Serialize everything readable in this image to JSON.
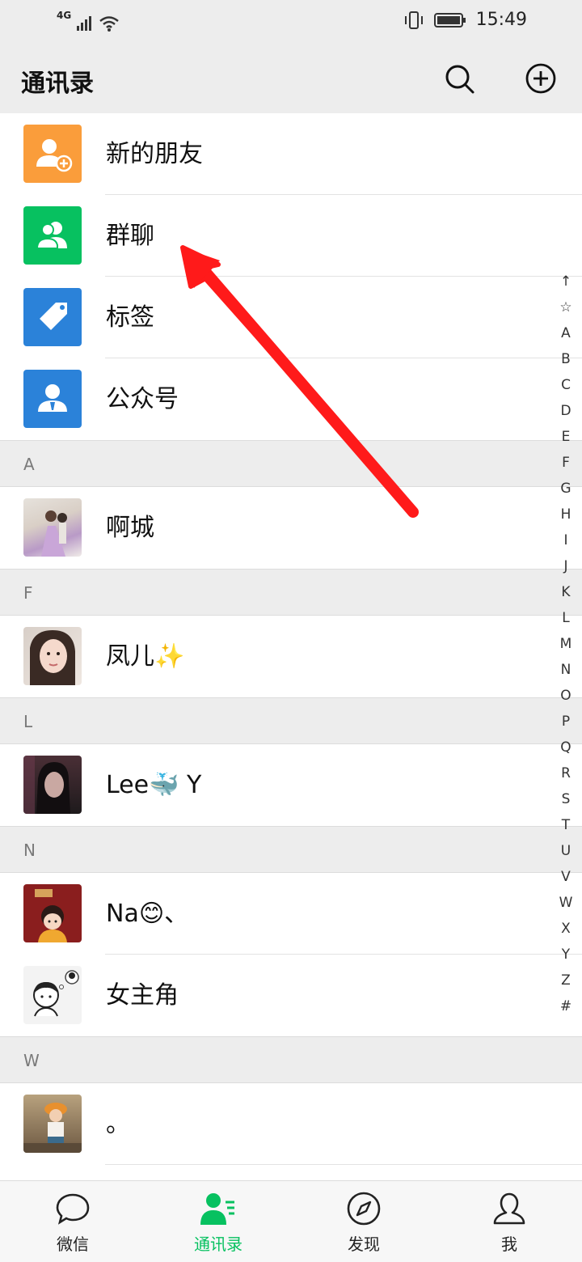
{
  "status": {
    "network": "4G",
    "time": "15:49"
  },
  "header": {
    "title": "通讯录"
  },
  "quick_items": [
    {
      "label": "新的朋友",
      "icon": "new-friend-icon",
      "color": "#fa9d3b"
    },
    {
      "label": "群聊",
      "icon": "group-chat-icon",
      "color": "#07c160"
    },
    {
      "label": "标签",
      "icon": "tag-icon",
      "color": "#2b82d9"
    },
    {
      "label": "公众号",
      "icon": "official-account-icon",
      "color": "#2b82d9"
    }
  ],
  "sections": [
    {
      "letter": "A",
      "contacts": [
        {
          "name": "啊城"
        }
      ]
    },
    {
      "letter": "F",
      "contacts": [
        {
          "name": "凤儿✨"
        }
      ]
    },
    {
      "letter": "L",
      "contacts": [
        {
          "name": "Lee🐳 Y"
        }
      ]
    },
    {
      "letter": "N",
      "contacts": [
        {
          "name": "Na😊、"
        },
        {
          "name": "女主角"
        }
      ]
    },
    {
      "letter": "W",
      "contacts": [
        {
          "name": "。"
        }
      ]
    }
  ],
  "index_letters": [
    "↑",
    "☆",
    "A",
    "B",
    "C",
    "D",
    "E",
    "F",
    "G",
    "H",
    "I",
    "J",
    "K",
    "L",
    "M",
    "N",
    "O",
    "P",
    "Q",
    "R",
    "S",
    "T",
    "U",
    "V",
    "W",
    "X",
    "Y",
    "Z",
    "#"
  ],
  "tabs": [
    {
      "label": "微信",
      "icon": "chat-bubble-icon"
    },
    {
      "label": "通讯录",
      "icon": "contacts-icon"
    },
    {
      "label": "发现",
      "icon": "compass-icon"
    },
    {
      "label": "我",
      "icon": "person-icon"
    }
  ],
  "colors": {
    "accent": "#07c160",
    "annotation_arrow": "#ff0000",
    "header_bg": "#ededed"
  }
}
